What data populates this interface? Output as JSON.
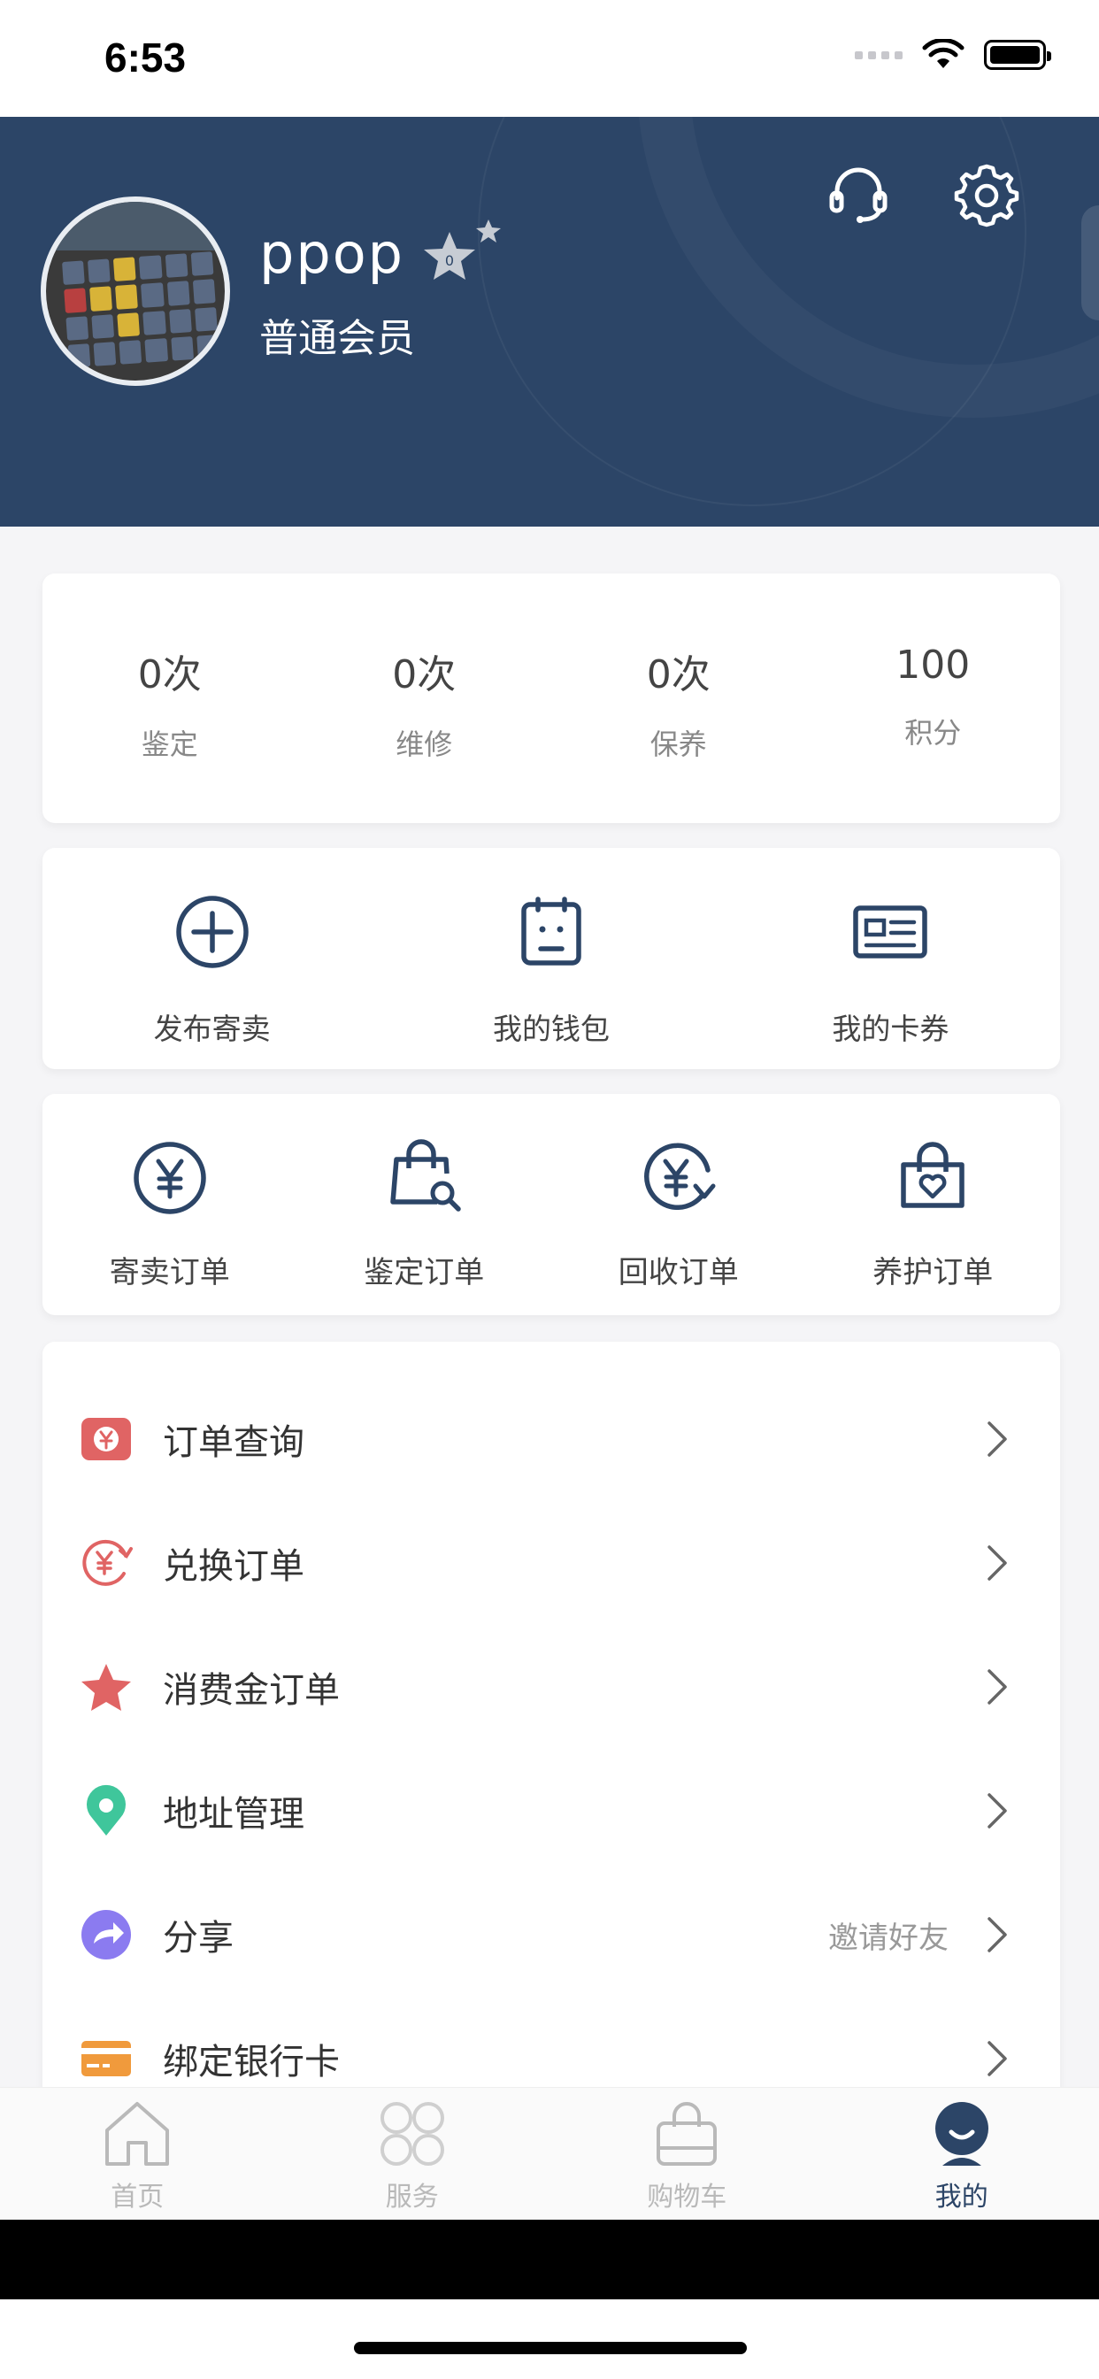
{
  "status_bar": {
    "time": "6:53"
  },
  "profile": {
    "username": "ppop",
    "member_level": "普通会员"
  },
  "stats": [
    {
      "value": "0次",
      "label": "鉴定"
    },
    {
      "value": "0次",
      "label": "维修"
    },
    {
      "value": "0次",
      "label": "保养"
    },
    {
      "value": "100",
      "label": "积分"
    }
  ],
  "quick_actions": [
    {
      "label": "发布寄卖",
      "icon": "plus-circle-icon"
    },
    {
      "label": "我的钱包",
      "icon": "wallet-icon"
    },
    {
      "label": "我的卡券",
      "icon": "card-coupon-icon"
    }
  ],
  "order_types": [
    {
      "label": "寄卖订单",
      "icon": "yen-circle-icon"
    },
    {
      "label": "鉴定订单",
      "icon": "bag-search-icon"
    },
    {
      "label": "回收订单",
      "icon": "yen-recycle-icon"
    },
    {
      "label": "养护订单",
      "icon": "bag-heart-icon"
    }
  ],
  "menu": [
    {
      "label": "订单查询",
      "hint": "",
      "icon": "order-query-icon",
      "color": "#e06464"
    },
    {
      "label": "兑换订单",
      "hint": "",
      "icon": "exchange-icon",
      "color": "#e06464"
    },
    {
      "label": "消费金订单",
      "hint": "",
      "icon": "star-icon",
      "color": "#e06464"
    },
    {
      "label": "地址管理",
      "hint": "",
      "icon": "location-pin-icon",
      "color": "#3fc69b"
    },
    {
      "label": "分享",
      "hint": "邀请好友",
      "icon": "share-icon",
      "color": "#8b7bf0"
    },
    {
      "label": "绑定银行卡",
      "hint": "",
      "icon": "bank-card-icon",
      "color": "#f09a3c"
    }
  ],
  "tabbar": [
    {
      "label": "首页",
      "icon": "home-icon",
      "active": false
    },
    {
      "label": "服务",
      "icon": "service-grid-icon",
      "active": false
    },
    {
      "label": "购物车",
      "icon": "cart-bag-icon",
      "active": false
    },
    {
      "label": "我的",
      "icon": "profile-icon",
      "active": true
    }
  ],
  "colors": {
    "header": "#2c4567",
    "accent": "#2c4567",
    "inactive": "#b9b9b9"
  }
}
